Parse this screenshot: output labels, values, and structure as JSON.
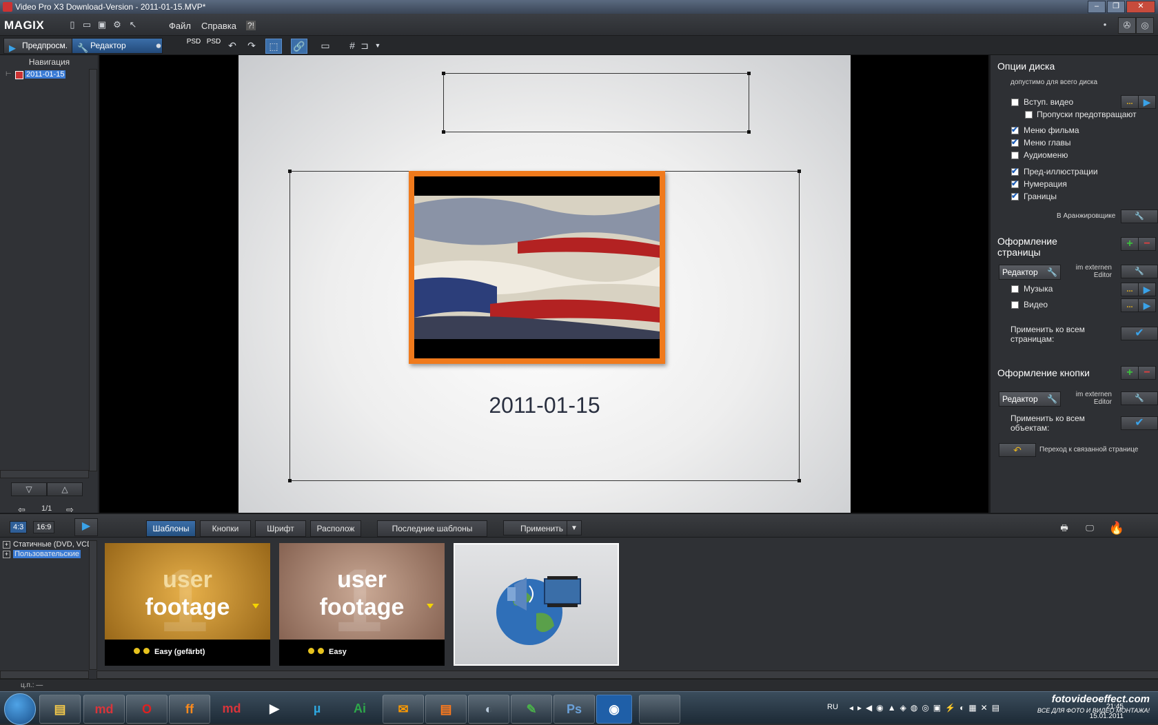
{
  "window": {
    "title": "Video Pro X3 Download-Version - 2011-01-15.MVP*",
    "buttons": [
      "–",
      "❐",
      "✕"
    ]
  },
  "app": {
    "logo": "MAGIX"
  },
  "menu": {
    "file": "Файл",
    "help": "Справка",
    "info": "?!"
  },
  "toolbar": {
    "preview_tab": "Предпросм.",
    "editor_tab": "Редактор",
    "psd1": "PSD",
    "psd2": "PSD"
  },
  "nav": {
    "header": "Навигация",
    "item": "2011-01-15",
    "page": "1/1"
  },
  "preview": {
    "page_title": "2011-01-15"
  },
  "disc_options": {
    "title": "Опции диска",
    "subtitle": "допустимо для всего диска",
    "intro_video": "Вступ. видео",
    "skip_prevent": "Пропуски предотвращают",
    "movie_menu": "Меню фильма",
    "chapter_menu": "Меню главы",
    "audio_menu": "Аудиоменю",
    "pre_illustrations": "Пред-иллюстрации",
    "numbering": "Нумерация",
    "borders": "Границы",
    "to_arranger": "В Аранжировщике",
    "dots": "..."
  },
  "page_design": {
    "title": "Оформление страницы",
    "editor": "Редактор",
    "external_editor": "im externen Editor",
    "music": "Музыка",
    "video": "Видео",
    "apply_all": "Применить ко всем страницам:"
  },
  "button_design": {
    "title": "Оформление кнопки",
    "editor": "Редактор",
    "external_editor": "im externen Editor",
    "apply_all": "Применить ко всем объектам:",
    "goto_linked": "Переход к связанной странице"
  },
  "bottom": {
    "aspect_43": "4:3",
    "aspect_169": "16:9",
    "tab_templates": "Шаблоны",
    "tab_buttons": "Кнопки",
    "tab_font": "Шрифт",
    "tab_layout": "Располож",
    "recent": "Последние шаблоны",
    "apply": "Применить"
  },
  "template_tree": {
    "static": "Статичные (DVD, VCD",
    "user": "Пользовательские"
  },
  "templates": [
    {
      "line1": "user",
      "line2": "footage",
      "label": "Easy (gefärbt)"
    },
    {
      "line1": "user",
      "line2": "footage",
      "label": "Easy"
    }
  ],
  "status": {
    "text": "ц.п.: —"
  },
  "taskbar": {
    "lang": "RU",
    "time": "21:45",
    "date": "15.01.2011",
    "watermark": "fotovideoeffect.com",
    "watermark_sub": "ВСЕ ДЛЯ ФОТО И ВИДЕО МОНТАЖА!",
    "apps": [
      "md",
      "O",
      "ff",
      "md",
      "▶",
      "µ",
      "Ai",
      "✉",
      "▤",
      "◐",
      "✎",
      "Ps",
      "◉"
    ]
  },
  "colors": {
    "accent": "#3b6ea8",
    "orange_frame": "#f07a1c",
    "check_blue": "#1f5fb8"
  }
}
